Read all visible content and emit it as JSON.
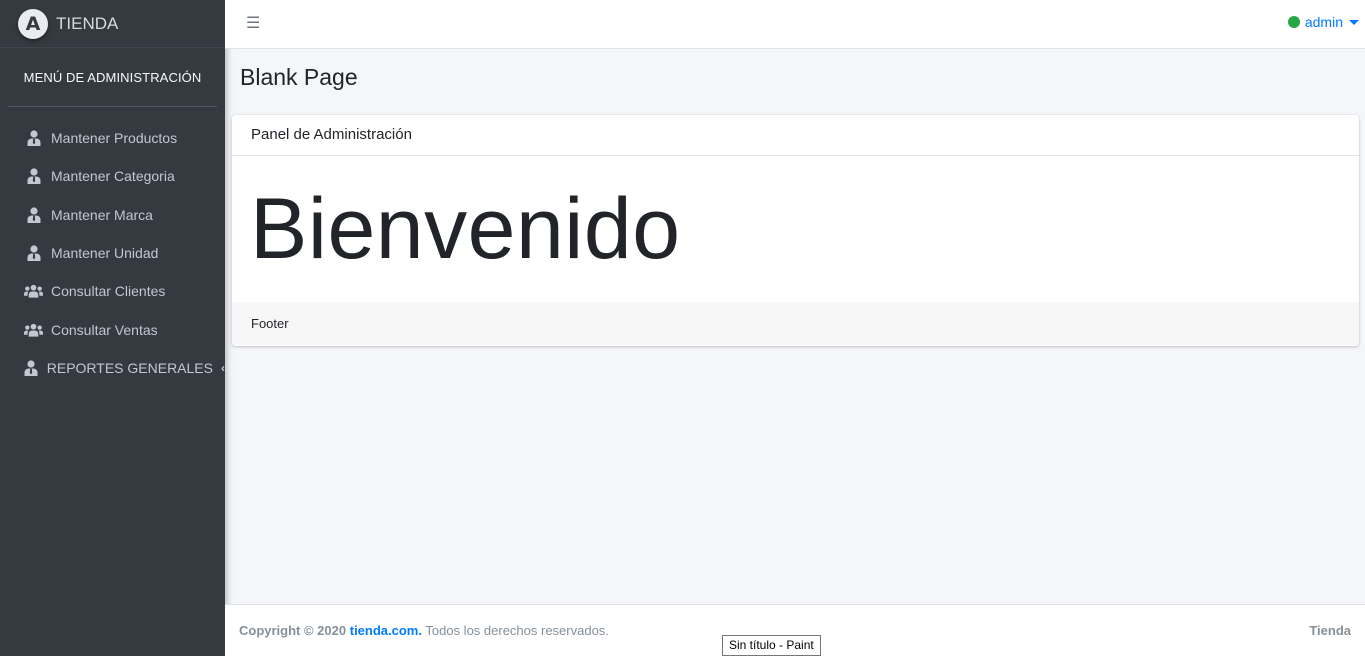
{
  "brand": {
    "logo_letter": "A",
    "name": "TIENDA"
  },
  "sidebar": {
    "header": "MENÚ DE ADMINISTRACIÓN",
    "items": [
      {
        "label": "Mantener Productos",
        "icon": "user-tie-icon"
      },
      {
        "label": "Mantener Categoria",
        "icon": "user-tie-icon"
      },
      {
        "label": "Mantener Marca",
        "icon": "user-tie-icon"
      },
      {
        "label": "Mantener Unidad",
        "icon": "user-tie-icon"
      },
      {
        "label": "Consultar Clientes",
        "icon": "users-icon"
      },
      {
        "label": "Consultar Ventas",
        "icon": "users-icon"
      },
      {
        "label": "REPORTES GENERALES",
        "icon": "user-tie-icon",
        "chevron": "‹"
      }
    ]
  },
  "navbar": {
    "menu_icon": "☰",
    "user_label": "admin",
    "status_color": "#28a745"
  },
  "page": {
    "title": "Blank Page"
  },
  "card": {
    "header": "Panel de Administración",
    "body": "Bienvenido",
    "footer": "Footer"
  },
  "footer": {
    "copyright": "Copyright © 2020",
    "site": "tienda.com.",
    "rights": "Todos los derechos reservados.",
    "right": "Tienda"
  },
  "taskbar_tooltip": "Sin título - Paint",
  "colors": {
    "sidebar": "#343a40",
    "accent": "#007bff",
    "background": "#f4f6f9"
  }
}
